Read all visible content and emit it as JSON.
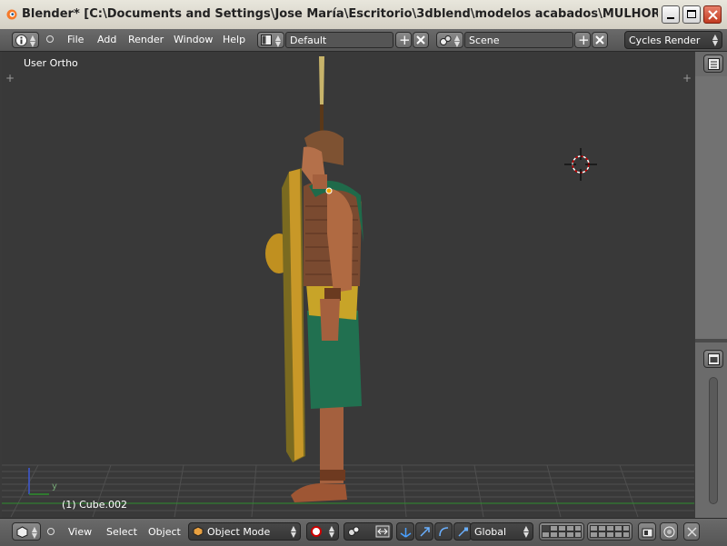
{
  "window": {
    "title": "Blender* [C:\\Documents and Settings\\Jose María\\Escritorio\\3dblend\\modelos acabados\\MULHORAND\\clerigos\\c..."
  },
  "menubar": {
    "menus": [
      "File",
      "Add",
      "Render",
      "Window",
      "Help"
    ],
    "screen_layout": "Default",
    "scene": "Scene",
    "render_engine": "Cycles Render"
  },
  "viewport": {
    "view_label": "User Ortho",
    "object_label": "(1) Cube.002",
    "axis_y": "y"
  },
  "statusbar": {
    "menus": [
      "View",
      "Select",
      "Object"
    ],
    "mode": "Object Mode",
    "orientation": "Global"
  },
  "colors": {
    "grid": "#505050",
    "x_axis": "#2e8f2e",
    "y_axis": "#3d59d6"
  }
}
